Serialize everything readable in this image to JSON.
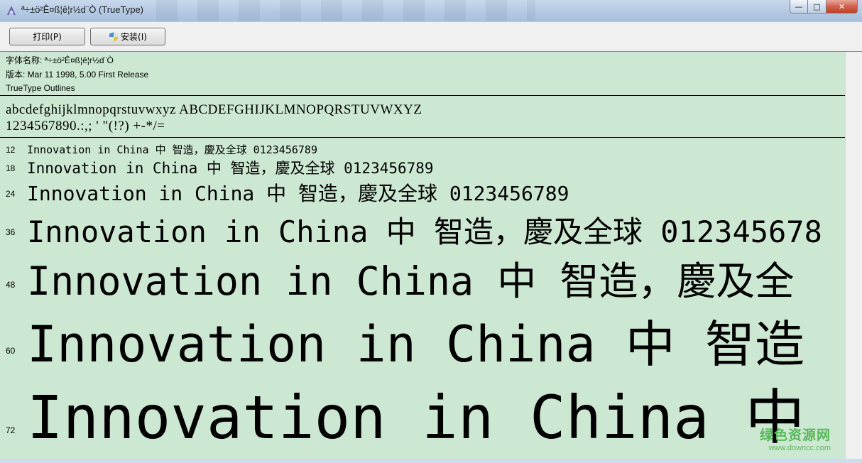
{
  "window": {
    "title": "ª÷±ö²Ê¤ß¦ê¦r½d¨Ò (TrueType)",
    "minimize_glyph": "—",
    "maximize_glyph": "□",
    "close_glyph": "✕"
  },
  "toolbar": {
    "print_label": "打印(P)",
    "install_label": "安装(I)"
  },
  "info": {
    "font_name_line": "字体名称: ª÷±ö²Ê¤ß¦ê¦r½d¨Ò",
    "version_line": "版本: Mar 11 1998, 5.00 First Release",
    "outlines_line": "TrueType Outlines"
  },
  "charset": {
    "letters": "abcdefghijklmnopqrstuvwxyz ABCDEFGHIJKLMNOPQRSTUVWXYZ",
    "digits_symbols": "1234567890.:,; ' \"(!?) +-*/="
  },
  "samples": [
    {
      "size": "12",
      "text": "Innovation in China 中  智造，慶及全球 0123456789"
    },
    {
      "size": "18",
      "text": "Innovation in China 中  智造，慶及全球 0123456789"
    },
    {
      "size": "24",
      "text": "Innovation in China 中  智造，慶及全球 0123456789"
    },
    {
      "size": "36",
      "text": "Innovation in China 中  智造，慶及全球 012345678"
    },
    {
      "size": "48",
      "text": "Innovation in China 中  智造，慶及全"
    },
    {
      "size": "60",
      "text": "Innovation in China 中  智造"
    },
    {
      "size": "72",
      "text": "Innovation in China 中"
    }
  ],
  "watermark": {
    "main": "绿色资源网",
    "sub": "www.downcc.com"
  },
  "colors": {
    "preview_background": "#cde8d2",
    "watermark_green": "#58b85a"
  }
}
